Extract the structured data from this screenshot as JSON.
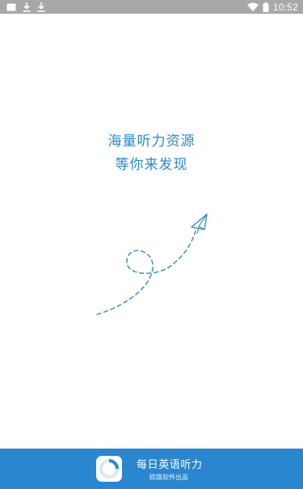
{
  "status_bar": {
    "time": "10:52",
    "left_icons": [
      "notification-card-icon",
      "download-icon",
      "download-icon"
    ],
    "right_icons": [
      "wifi-icon",
      "battery-icon"
    ],
    "background": "#a8a8a8"
  },
  "main": {
    "headline_line1": "海量听力资源",
    "headline_line2": "等你来发现",
    "accent_color": "#2a87cf",
    "illustration": "paper-plane-icon"
  },
  "footer": {
    "app_name": "每日英语听力",
    "publisher": "欧路软件出品",
    "logo_icon": "app-logo-icon",
    "background": "#2a87cf"
  }
}
